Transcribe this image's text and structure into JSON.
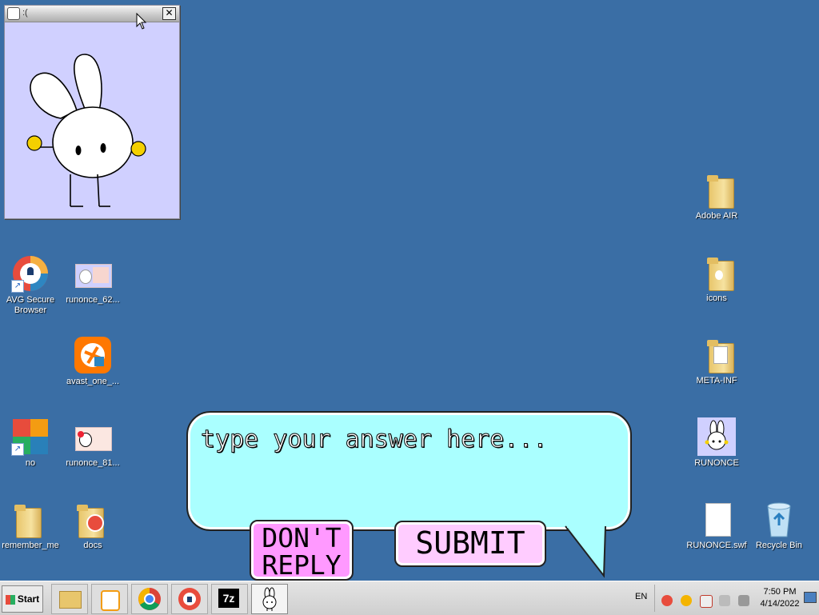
{
  "window": {
    "title": ":("
  },
  "desktop_icons": [
    {
      "id": "avg",
      "label": "AVG Secure Browser",
      "icon": "avg-browser-icon"
    },
    {
      "id": "runonce62",
      "label": "runonce_62...",
      "icon": "image-thumbnail-icon"
    },
    {
      "id": "avast",
      "label": "avast_one_...",
      "icon": "avast-icon"
    },
    {
      "id": "no",
      "label": "no",
      "icon": "avast-shortcut-icon"
    },
    {
      "id": "runonce81",
      "label": "runonce_81...",
      "icon": "image-thumbnail-icon"
    },
    {
      "id": "remember_me",
      "label": "remember_me",
      "icon": "folder-icon"
    },
    {
      "id": "docs",
      "label": "docs",
      "icon": "folder-icon"
    },
    {
      "id": "adobe_air",
      "label": "Adobe AIR",
      "icon": "folder-icon"
    },
    {
      "id": "icons",
      "label": "icons",
      "icon": "folder-icon"
    },
    {
      "id": "meta_inf",
      "label": "META-INF",
      "icon": "folder-icon"
    },
    {
      "id": "runonce",
      "label": "RUNONCE",
      "icon": "runonce-app-icon"
    },
    {
      "id": "runonce_swf",
      "label": "RUNONCE.swf",
      "icon": "file-icon"
    },
    {
      "id": "recycle",
      "label": "Recycle Bin",
      "icon": "recycle-bin-icon"
    }
  ],
  "dialog": {
    "placeholder": "type your answer here...",
    "dont_reply_line1": "DON'T",
    "dont_reply_line2": "REPLY",
    "submit_label": "SUBMIT"
  },
  "taskbar": {
    "start_label": "Start",
    "language": "EN",
    "time": "7:50 PM",
    "date": "4/14/2022"
  },
  "colors": {
    "desktop": "#3a6ea5",
    "bubble": "#aaffff",
    "dont_reply": "#ff99ff",
    "submit": "#ffccff",
    "window_bg": "#d0d0ff"
  }
}
